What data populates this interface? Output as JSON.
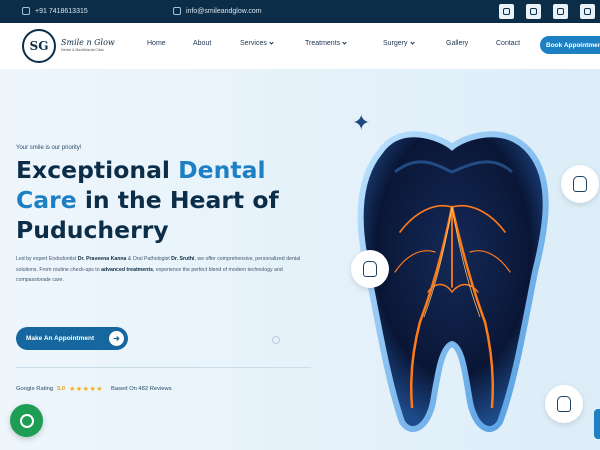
{
  "topbar": {
    "phone": "+91 7418613315",
    "email": "info@smileandglow.com",
    "social_icons": [
      "facebook-icon",
      "youtube-icon",
      "instagram-icon",
      "google-icon"
    ]
  },
  "nav": {
    "logo_name": "Smile n Glow",
    "logo_sub": "Dental & Maxillofacial Clinic",
    "items": [
      {
        "label": "Home"
      },
      {
        "label": "About"
      },
      {
        "label": "Services"
      },
      {
        "label": "Treatments"
      },
      {
        "label": "Surgery"
      },
      {
        "label": "Gallery"
      },
      {
        "label": "Contact"
      }
    ],
    "book_label": "Book Appointment"
  },
  "hero": {
    "tagline": "Your smile is our priority!",
    "headline_1": "Exceptional ",
    "headline_accent": "Dental",
    "headline_2": "Care",
    "headline_3": " in the Heart of",
    "headline_4": "Puducherry",
    "body_1": "Led by expert Endodontist ",
    "body_doctor1": "Dr. Praveena Kanna",
    "body_2": " & Oral Pathologist ",
    "body_doctor2": "Dr. Sruthi",
    "body_3": ", we offer comprehensive, personalized dental solutions. From routine check-ups to ",
    "body_bold": "advanced treatments",
    "body_4": ", experience the perfect blend of modern technology and compassionate care.",
    "cta_label": "Make An Appointment",
    "rating_label": "Google Rating",
    "rating_value": "5.0",
    "stars": "★★★★★",
    "reviews": "Based On 482 Reviews"
  },
  "colors": {
    "navy": "#0c2d48",
    "accent": "#1d7fc4",
    "whatsapp": "#1e9d55"
  }
}
